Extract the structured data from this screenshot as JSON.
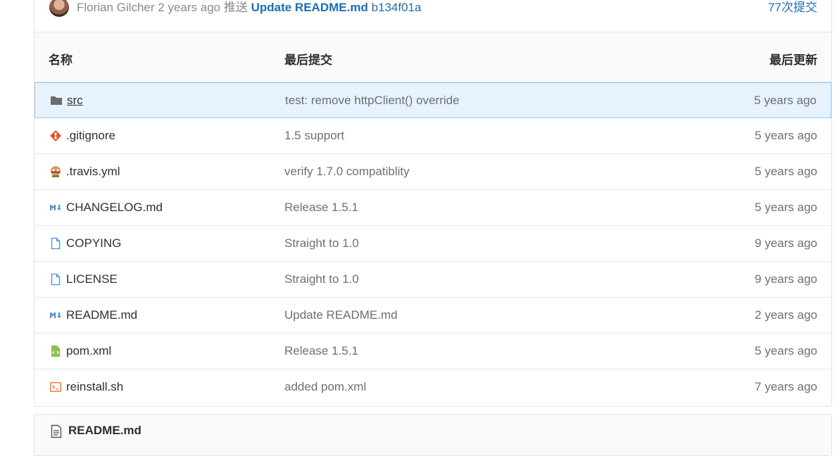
{
  "last_commit": {
    "author": "Florian Gilcher",
    "time_ago": "2 years ago",
    "verb": "推送",
    "message": "Update README.md",
    "hash": "b134f01a",
    "commits_count": "77次提交"
  },
  "table": {
    "headers": {
      "name": "名称",
      "last_commit": "最后提交",
      "last_updated": "最后更新"
    },
    "rows": [
      {
        "icon": "folder-icon",
        "name": "src",
        "message": "test: remove httpClient() override",
        "updated": "5 years ago"
      },
      {
        "icon": "git-icon",
        "name": ".gitignore",
        "message": "1.5 support",
        "updated": "5 years ago"
      },
      {
        "icon": "travis-icon",
        "name": ".travis.yml",
        "message": "verify 1.7.0 compatiblity",
        "updated": "5 years ago"
      },
      {
        "icon": "markdown-icon",
        "name": "CHANGELOG.md",
        "message": "Release 1.5.1",
        "updated": "5 years ago"
      },
      {
        "icon": "file-icon",
        "name": "COPYING",
        "message": "Straight to 1.0",
        "updated": "9 years ago"
      },
      {
        "icon": "file-icon",
        "name": "LICENSE",
        "message": "Straight to 1.0",
        "updated": "9 years ago"
      },
      {
        "icon": "markdown-icon",
        "name": "README.md",
        "message": "Update README.md",
        "updated": "2 years ago"
      },
      {
        "icon": "xml-icon",
        "name": "pom.xml",
        "message": "Release 1.5.1",
        "updated": "5 years ago"
      },
      {
        "icon": "terminal-icon",
        "name": "reinstall.sh",
        "message": "added pom.xml",
        "updated": "7 years ago"
      }
    ]
  },
  "readme": {
    "title": "README.md"
  },
  "colors": {
    "link": "#1f6fb3",
    "selected_bg": "#e6f2fd",
    "selected_border": "#9ccaf2"
  }
}
